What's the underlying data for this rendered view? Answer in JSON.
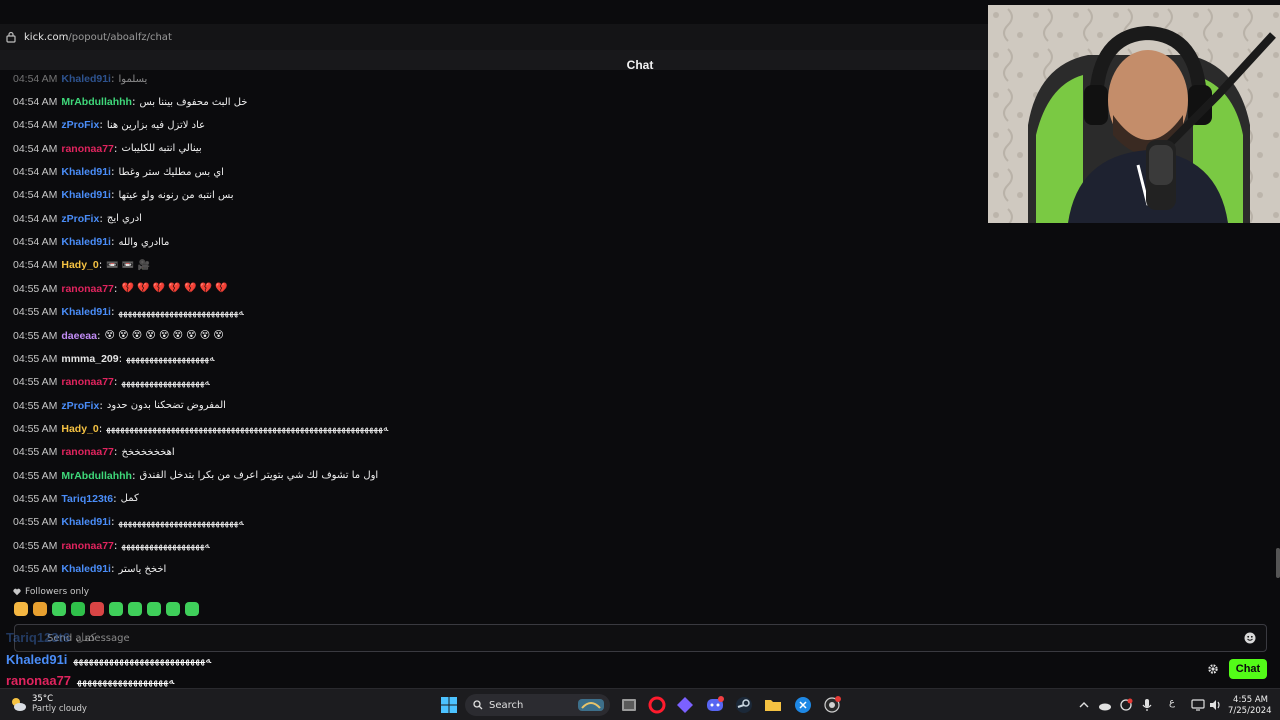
{
  "browser": {
    "url_domain": "kick.com",
    "url_path": "/popout/aboalfz/chat"
  },
  "chat": {
    "title": "Chat",
    "cutoff_message": {
      "time": "04:54 AM",
      "user": "Khaled91i",
      "color": "#4a8df8",
      "text": "يسلموا"
    },
    "messages": [
      {
        "time": "04:54 AM",
        "user": "MrAbdullahhh",
        "color": "#3fd87a",
        "text": "خل البث محفوف بيننا بس"
      },
      {
        "time": "04:54 AM",
        "user": "zProFix",
        "color": "#4a8df8",
        "text": "عاد لاتزل فيه بزارين هنا"
      },
      {
        "time": "04:54 AM",
        "user": "ranonaa77",
        "color": "#e0245e",
        "text": "بينالي انتبه للكليبات"
      },
      {
        "time": "04:54 AM",
        "user": "Khaled91i",
        "color": "#4a8df8",
        "text": "اي بس مطليك ستر وغطا"
      },
      {
        "time": "04:54 AM",
        "user": "Khaled91i",
        "color": "#4a8df8",
        "text": "بس انتبه من رنونه ولو عيتها"
      },
      {
        "time": "04:54 AM",
        "user": "zProFix",
        "color": "#4a8df8",
        "text": "ادري ايج"
      },
      {
        "time": "04:54 AM",
        "user": "Khaled91i",
        "color": "#4a8df8",
        "text": "ماادري والله"
      },
      {
        "time": "04:54 AM",
        "user": "Hady_0",
        "color": "#f5c242",
        "text": "📼 📼 🎥"
      },
      {
        "time": "04:55 AM",
        "user": "ranonaa77",
        "color": "#e0245e",
        "text": "💔 💔 💔 💔 💔 💔 💔"
      },
      {
        "time": "04:55 AM",
        "user": "Khaled91i",
        "color": "#4a8df8",
        "text": "ﻪﻬﻬﻬﻬﻬﻬﻬﻬﻬﻬﻬﻬﻬﻬﻬﻬﻬﻬﻬﻬﻬﻬﻬﻬﻬﻬ"
      },
      {
        "time": "04:55 AM",
        "user": "daeeaa",
        "color": "#c28cf5",
        "text": "😵 😵 😵 😵 😵 😵 😵 😵 😵"
      },
      {
        "time": "04:55 AM",
        "user": "mmma_209",
        "color": "#e5e5e5",
        "text": "ﻪﻬﻬﻬﻬﻬﻬﻬﻬﻬﻬﻬﻬﻬﻬﻬﻬﻬﻬ"
      },
      {
        "time": "04:55 AM",
        "user": "ranonaa77",
        "color": "#e0245e",
        "text": "ﻪﻬﻬﻬﻬﻬﻬﻬﻬﻬﻬﻬﻬﻬﻬﻬﻬﻬﻬ"
      },
      {
        "time": "04:55 AM",
        "user": "zProFix",
        "color": "#4a8df8",
        "text": "المفروض تضحكنا بدون حدود"
      },
      {
        "time": "04:55 AM",
        "user": "Hady_0",
        "color": "#f5c242",
        "text": "ﻪﻬﻬﻬﻬﻬﻬﻬﻬﻬﻬﻬﻬﻬﻬﻬﻬﻬﻬﻬﻬﻬﻬﻬﻬﻬﻬﻬﻬﻬﻬﻬﻬﻬﻬﻬﻬﻬﻬﻬﻬﻬﻬﻬﻬﻬﻬﻬﻬﻬﻬﻬﻬﻬﻬﻬﻬﻬﻬﻬﻬ"
      },
      {
        "time": "04:55 AM",
        "user": "ranonaa77",
        "color": "#e0245e",
        "text": "اهخخخخخخخ"
      },
      {
        "time": "04:55 AM",
        "user": "MrAbdullahhh",
        "color": "#3fd87a",
        "text": "اول ما تشوف لك شي بتويتر اعرف من بكرا بتدخل الفندق"
      },
      {
        "time": "04:55 AM",
        "user": "Tariq123t6",
        "color": "#4a8df8",
        "text": "كمل"
      },
      {
        "time": "04:55 AM",
        "user": "Khaled91i",
        "color": "#4a8df8",
        "text": "ﻪﻬﻬﻬﻬﻬﻬﻬﻬﻬﻬﻬﻬﻬﻬﻬﻬﻬﻬﻬﻬﻬﻬﻬﻬﻬﻬ"
      },
      {
        "time": "04:55 AM",
        "user": "ranonaa77",
        "color": "#e0245e",
        "text": "ﻪﻬﻬﻬﻬﻬﻬﻬﻬﻬﻬﻬﻬﻬﻬﻬﻬﻬﻬ"
      },
      {
        "time": "04:55 AM",
        "user": "Khaled91i",
        "color": "#4a8df8",
        "text": "اخخخ ياستر"
      }
    ],
    "followers_only": "Followers only",
    "input_placeholder": "Send a message",
    "send_button": "Chat",
    "emote_colors": [
      "#f5b742",
      "#e8a030",
      "#3fcf5a",
      "#2fc04a",
      "#d94545",
      "#3fcf5a",
      "#3fcf5a",
      "#3fcf5a",
      "#3fcf5a",
      "#3fcf5a"
    ]
  },
  "overlay": {
    "lines": [
      {
        "user": "Tariq123t6",
        "color": "#4a8df8",
        "text": "كمل"
      },
      {
        "user": "Khaled91i",
        "color": "#4a8df8",
        "text": "ﻪﻬﻬﻬﻬﻬﻬﻬﻬﻬﻬﻬﻬﻬﻬﻬﻬﻬﻬﻬﻬﻬﻬﻬﻬﻬﻬ"
      },
      {
        "user": "ranonaa77",
        "color": "#e0245e",
        "text": "ﻪﻬﻬﻬﻬﻬﻬﻬﻬﻬﻬﻬﻬﻬﻬﻬﻬﻬﻬ"
      },
      {
        "user": "Khaled91i",
        "color": "#4a8df8",
        "text": "اخخخ ياستر"
      }
    ]
  },
  "taskbar": {
    "weather_temp": "35°C",
    "weather_desc": "Partly cloudy",
    "search_label": "Search",
    "ime": "ع",
    "time": "4:55 AM",
    "date": "7/25/2024"
  }
}
